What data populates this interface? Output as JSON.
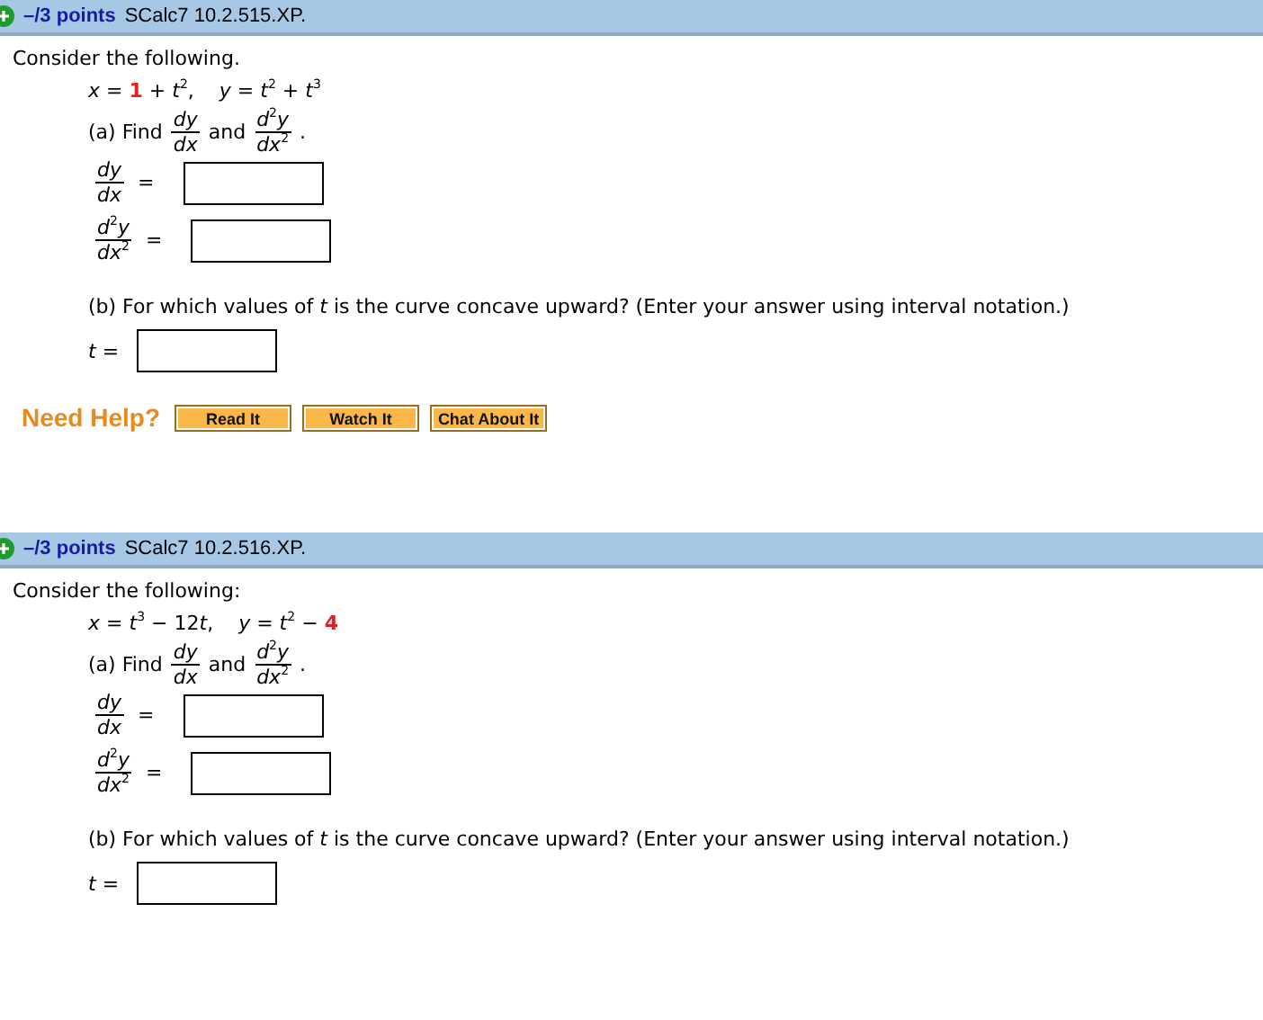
{
  "problems": [
    {
      "header": {
        "points": "–/3 points",
        "code": "SCalc7 10.2.515.XP."
      },
      "intro": "Consider the following.",
      "equation": [
        {
          "kind": "plain",
          "text": "*x* = "
        },
        {
          "kind": "random",
          "text": "1"
        },
        {
          "kind": "plain",
          "text": " + *t*$^{2}$,    *y* = *t*$^{2}$ + *t*$^{3}$"
        }
      ],
      "find": [
        {
          "kind": "text",
          "text": "(a) Find"
        },
        {
          "kind": "fraction",
          "numerator": "*dy*",
          "denominator": "*dx*"
        },
        {
          "kind": "text",
          "text": "and"
        },
        {
          "kind": "fraction",
          "numerator": "*d*$^{2}$*y*",
          "denominator": "*dx*$^{2}$"
        },
        {
          "kind": "text",
          "text": "."
        }
      ],
      "answers": [
        {
          "numerator": "*dy*",
          "denominator": "*dx*",
          "sign": "="
        },
        {
          "numerator": "*d*$^{2}$*y*",
          "denominator": "*dx*$^{2}$",
          "sign": "="
        }
      ],
      "part_b": "(b) For which values of *t* is the curve concave upward? (Enter your answer using interval notation.)",
      "t_label": "*t* =",
      "help": {
        "label": "Need Help?",
        "buttons": [
          "Read It",
          "Watch It",
          "Chat About It"
        ]
      }
    },
    {
      "header": {
        "points": "–/3 points",
        "code": "SCalc7 10.2.516.XP."
      },
      "intro": "Consider the following:",
      "equation": [
        {
          "kind": "plain",
          "text": "*x* = *t*$^{3}$ − 12"
        },
        {
          "kind": "plain",
          "text": "*t*,    *y* = *t*$^{2}$ − "
        },
        {
          "kind": "random",
          "text": "4"
        }
      ],
      "find": [
        {
          "kind": "text",
          "text": "(a) Find"
        },
        {
          "kind": "fraction",
          "numerator": "*dy*",
          "denominator": "*dx*"
        },
        {
          "kind": "text",
          "text": "and"
        },
        {
          "kind": "fraction",
          "numerator": "*d*$^{2}$*y*",
          "denominator": "*dx*$^{2}$"
        },
        {
          "kind": "text",
          "text": "."
        }
      ],
      "answers": [
        {
          "numerator": "*dy*",
          "denominator": "*dx*",
          "sign": "="
        },
        {
          "numerator": "*d*$^{2}$*y*",
          "denominator": "*dx*$^{2}$",
          "sign": "="
        }
      ],
      "part_b": "(b) For which values of *t* is the curve concave upward? (Enter your answer using interval notation.)",
      "t_label": "*t* ="
    }
  ]
}
